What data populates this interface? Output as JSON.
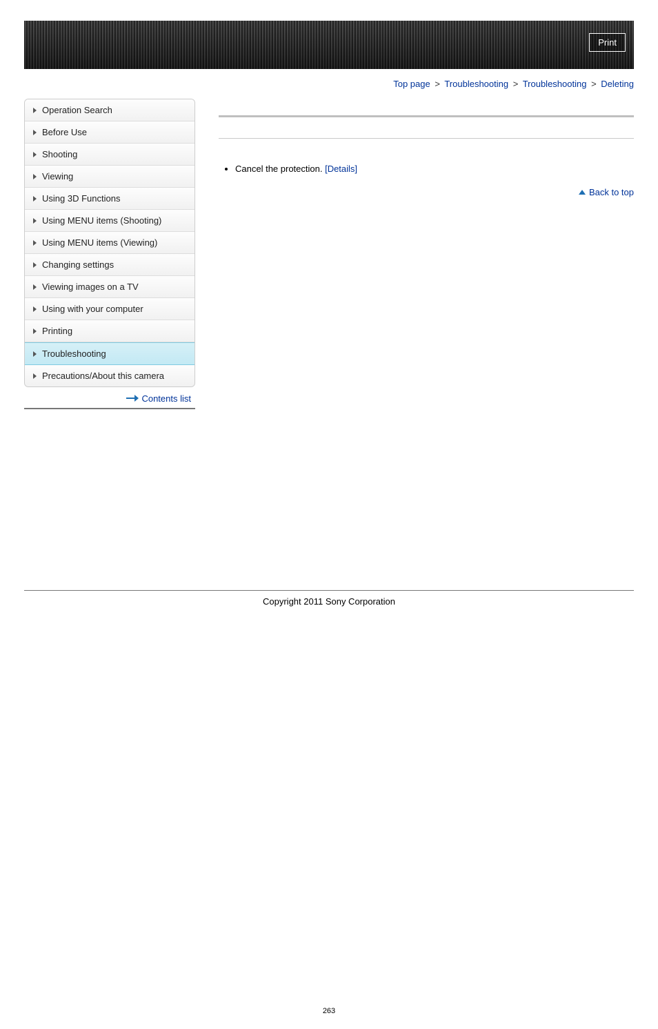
{
  "header": {
    "print_label": "Print"
  },
  "breadcrumb": {
    "items": [
      "Top page",
      "Troubleshooting",
      "Troubleshooting",
      "Deleting"
    ],
    "sep": ">"
  },
  "sidebar": {
    "items": [
      {
        "label": "Operation Search",
        "active": false
      },
      {
        "label": "Before Use",
        "active": false
      },
      {
        "label": "Shooting",
        "active": false
      },
      {
        "label": "Viewing",
        "active": false
      },
      {
        "label": "Using 3D Functions",
        "active": false
      },
      {
        "label": "Using MENU items (Shooting)",
        "active": false
      },
      {
        "label": "Using MENU items (Viewing)",
        "active": false
      },
      {
        "label": "Changing settings",
        "active": false
      },
      {
        "label": "Viewing images on a TV",
        "active": false
      },
      {
        "label": "Using with your computer",
        "active": false
      },
      {
        "label": "Printing",
        "active": false
      },
      {
        "label": "Troubleshooting",
        "active": true
      },
      {
        "label": "Precautions/About this camera",
        "active": false
      }
    ],
    "contents_list_label": "Contents list"
  },
  "main": {
    "bullet_text": "Cancel the protection. ",
    "details_label": "[Details]",
    "back_to_top_label": "Back to top"
  },
  "footer": {
    "copyright": "Copyright 2011 Sony Corporation",
    "page_number": "263"
  }
}
